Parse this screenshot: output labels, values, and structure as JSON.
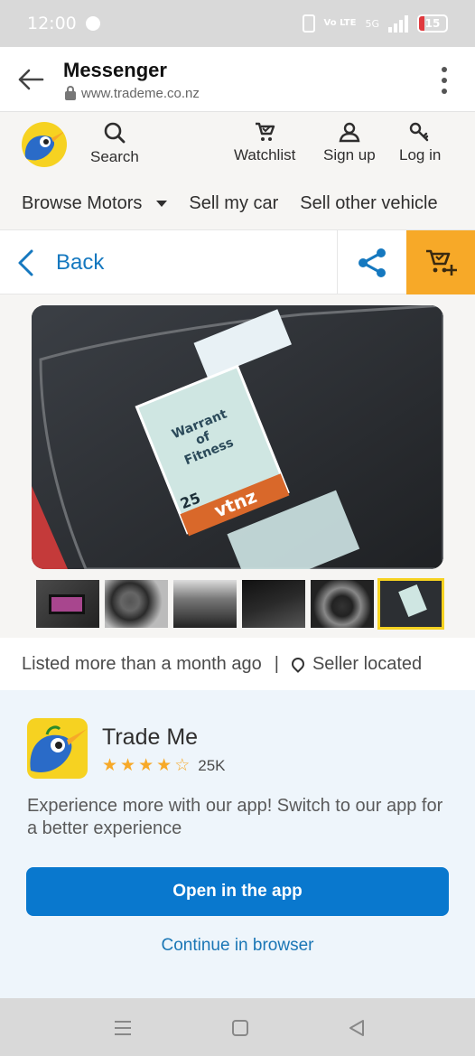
{
  "status_bar": {
    "time": "12:00",
    "network": "Vo LTE",
    "signal_label": "5G",
    "battery": "15"
  },
  "browser": {
    "title": "Messenger",
    "url": "www.trademe.co.nz"
  },
  "header": {
    "search_label": "Search",
    "watchlist_label": "Watchlist",
    "signup_label": "Sign up",
    "login_label": "Log in"
  },
  "motors_nav": {
    "browse_label": "Browse Motors",
    "sell_car_label": "Sell my car",
    "sell_other_label": "Sell other vehicle"
  },
  "back_bar": {
    "back_label": "Back"
  },
  "photo": {
    "sticker_line1": "Warrant",
    "sticker_line2": "of",
    "sticker_line3": "Fitness",
    "sticker_brand": "vtnz",
    "sticker_number": "25",
    "thumbnail_count": 6,
    "selected_thumbnail": 6
  },
  "listing": {
    "listed_text": "Listed more than a month ago",
    "separator": "|",
    "seller_text": "Seller located"
  },
  "app_promo": {
    "app_name": "Trade Me",
    "rating": 4.5,
    "rating_count": "25K",
    "description": "Experience more with our app! Switch to our app for a better experience",
    "open_button": "Open in the app",
    "continue_link": "Continue in browser"
  },
  "colors": {
    "accent_blue": "#0978ce",
    "watch_orange": "#f7a928",
    "kiwi_yellow": "#f6d221"
  }
}
